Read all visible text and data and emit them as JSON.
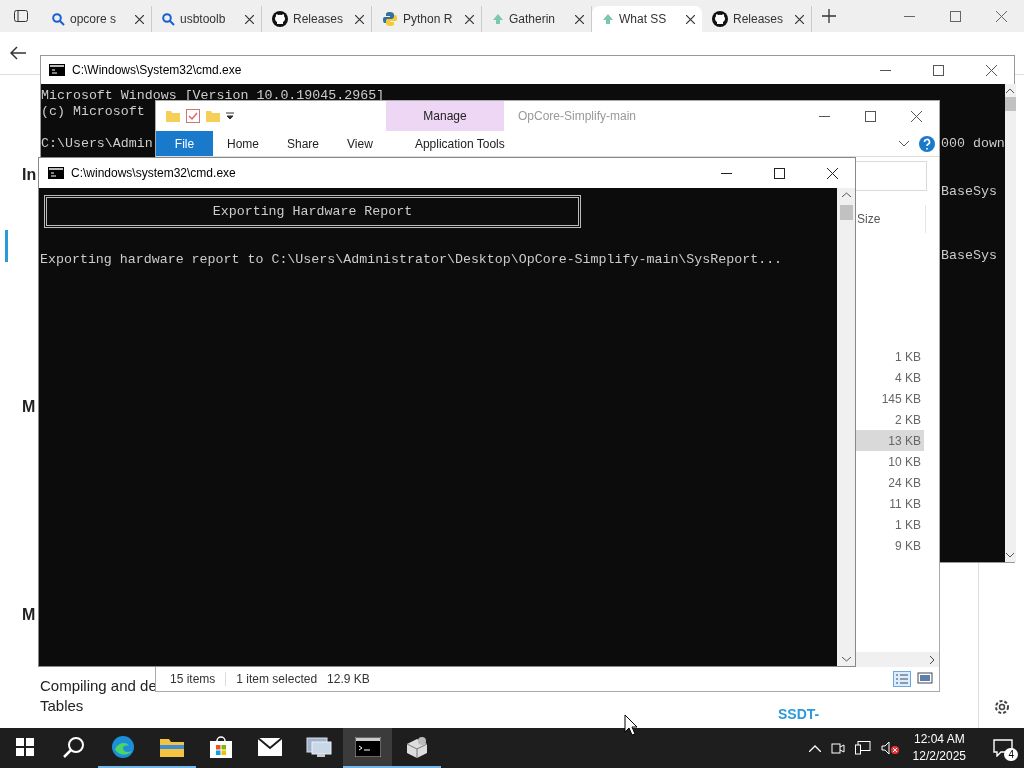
{
  "browser": {
    "tabs": [
      {
        "label": "opcore s",
        "kind": "search",
        "selected": false
      },
      {
        "label": "usbtoolb",
        "kind": "search",
        "selected": false
      },
      {
        "label": "Releases",
        "kind": "github",
        "selected": false
      },
      {
        "label": "Python R",
        "kind": "python",
        "selected": false
      },
      {
        "label": "Gatherin",
        "kind": "arrow",
        "selected": false
      },
      {
        "label": "What SS",
        "kind": "arrow",
        "selected": true
      },
      {
        "label": "Releases",
        "kind": "github",
        "selected": false
      }
    ],
    "page": {
      "headings": [
        "In",
        "M",
        "M"
      ],
      "link_text": [
        "Compiling and de",
        "Tables"
      ],
      "table_text": "SSDT-"
    }
  },
  "back_console": {
    "title": "C:\\Windows\\System32\\cmd.exe",
    "lines": [
      {
        "kind": "text",
        "start": "Microsoft Windows [Version 10.0.19045.2965]"
      },
      {
        "kind": "text",
        "start": "(c) Microsoft"
      },
      {
        "kind": "blank"
      },
      {
        "kind": "text",
        "start": "C:\\Users\\Admin",
        "end": "000 down"
      },
      {
        "kind": "blank"
      },
      {
        "kind": "blank"
      },
      {
        "kind": "text",
        "end": "BaseSys"
      },
      {
        "kind": "blank"
      },
      {
        "kind": "blank"
      },
      {
        "kind": "blank"
      },
      {
        "kind": "text",
        "end": "BaseSys"
      }
    ]
  },
  "explorer": {
    "title": "OpCore-Simplify-main",
    "context_tab": "Manage",
    "ribbon_tabs": [
      {
        "label": "File",
        "kind": "file"
      },
      {
        "label": "Home",
        "kind": "normal"
      },
      {
        "label": "Share",
        "kind": "normal"
      },
      {
        "label": "View",
        "kind": "normal"
      },
      {
        "label": "Application Tools",
        "kind": "context"
      }
    ],
    "size_header": "Size",
    "sizes": [
      {
        "size": "1 KB",
        "selected": false
      },
      {
        "size": "4 KB",
        "selected": false
      },
      {
        "size": "145 KB",
        "selected": false
      },
      {
        "size": "2 KB",
        "selected": false
      },
      {
        "size": "13 KB",
        "selected": true
      },
      {
        "size": "10 KB",
        "selected": false
      },
      {
        "size": "24 KB",
        "selected": false
      },
      {
        "size": "11 KB",
        "selected": false
      },
      {
        "size": "1 KB",
        "selected": false
      },
      {
        "size": "9 KB",
        "selected": false
      }
    ],
    "status": {
      "items": "15 items",
      "selection": "1 item selected",
      "selection_size": "12.9 KB"
    }
  },
  "front_console": {
    "title": "C:\\windows\\system32\\cmd.exe",
    "banner": "Exporting Hardware Report",
    "lines": [
      "Exporting hardware report to C:\\Users\\Administrator\\Desktop\\OpCore-Simplify-main\\SysReport..."
    ]
  },
  "taskbar": {
    "apps": [
      {
        "kind": "start",
        "running": false,
        "selected": false
      },
      {
        "kind": "search",
        "running": false,
        "selected": false
      },
      {
        "kind": "edge",
        "running": true,
        "selected": false
      },
      {
        "kind": "folder",
        "running": true,
        "selected": false
      },
      {
        "kind": "store",
        "running": false,
        "selected": false
      },
      {
        "kind": "mail",
        "running": false,
        "selected": false
      },
      {
        "kind": "monitor",
        "running": false,
        "selected": false
      },
      {
        "kind": "console",
        "running": true,
        "selected": true
      },
      {
        "kind": "package",
        "running": true,
        "selected": false
      }
    ],
    "time": "12:04 AM",
    "date": "12/2/2025",
    "notifications": "4"
  }
}
